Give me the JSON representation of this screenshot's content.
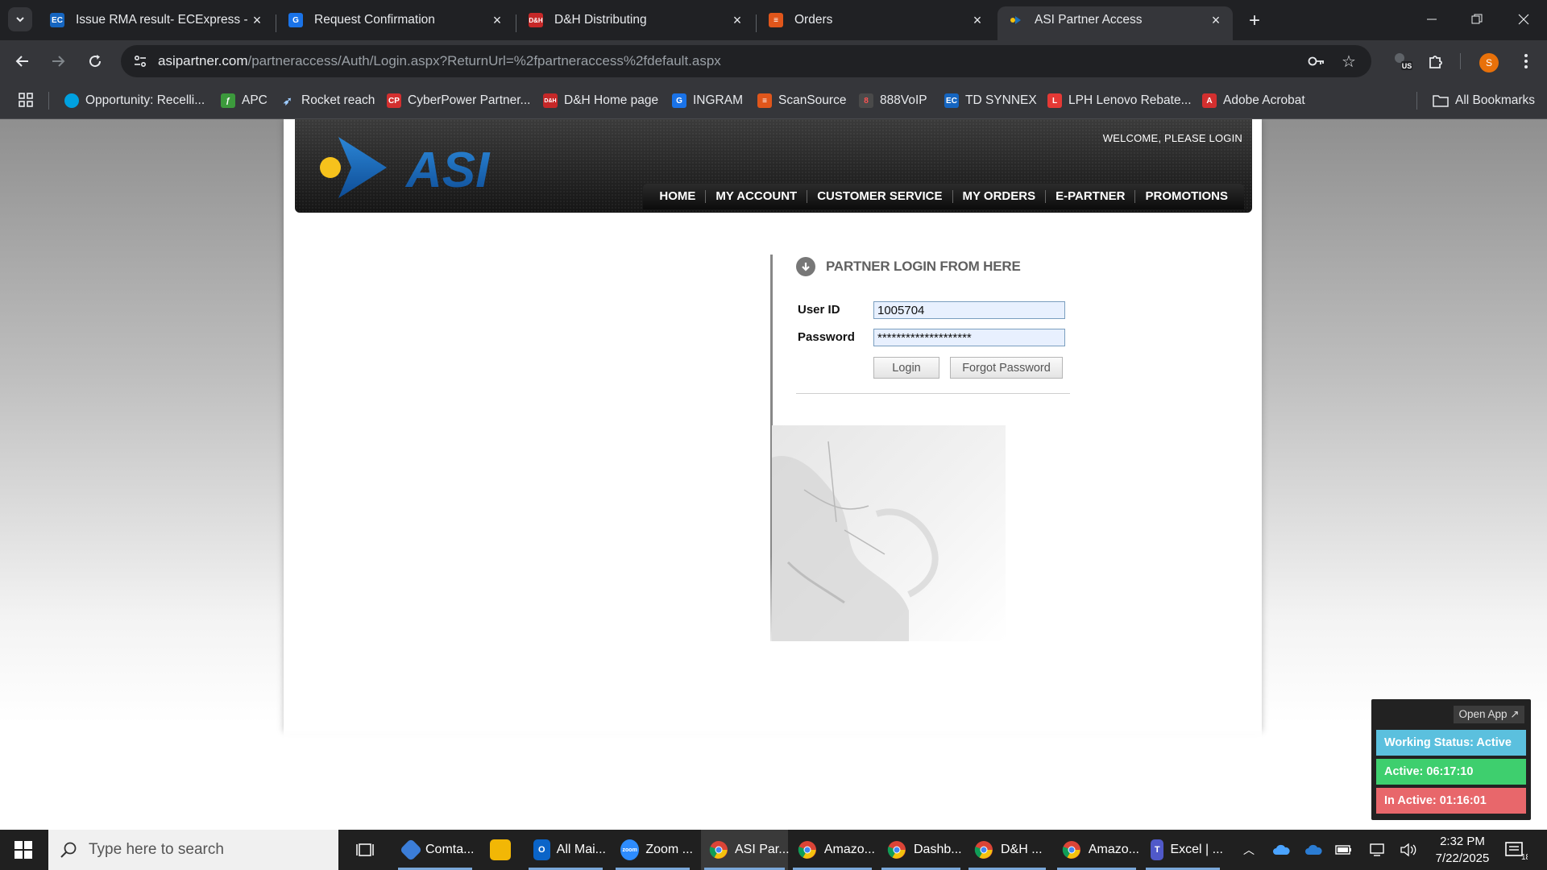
{
  "browser": {
    "tabs": [
      {
        "title": "Issue RMA result- ECExpress - T",
        "favicon": "ec-icon",
        "active": false
      },
      {
        "title": "Request Confirmation",
        "favicon": "g-icon",
        "active": false
      },
      {
        "title": "D&H Distributing",
        "favicon": "dh-icon",
        "active": false
      },
      {
        "title": "Orders",
        "favicon": "orders-icon",
        "active": false
      },
      {
        "title": "ASI Partner Access",
        "favicon": "asi-icon",
        "active": true
      }
    ],
    "address": {
      "host": "asipartner.com",
      "path": "/partneraccess/Auth/Login.aspx?ReturnUrl=%2fpartneraccess%2fdefault.aspx"
    },
    "profile_initial": "S",
    "extension_badge": "US",
    "bookmarks": [
      {
        "label": "Opportunity: Recelli...",
        "icon": "salesforce-icon",
        "color": "#00a1e0"
      },
      {
        "label": "APC",
        "icon": "apc-icon",
        "color": "#3c9a3c"
      },
      {
        "label": "Rocket reach",
        "icon": "rocket-icon",
        "color": "#6a5acd"
      },
      {
        "label": "CyberPower Partner...",
        "icon": "cp-icon",
        "color": "#d32f2f"
      },
      {
        "label": "D&H Home page",
        "icon": "dh-icon",
        "color": "#c62828"
      },
      {
        "label": "INGRAM",
        "icon": "g-icon",
        "color": "#1a73e8"
      },
      {
        "label": "ScanSource",
        "icon": "scansource-icon",
        "color": "#e0561b"
      },
      {
        "label": "888VoIP",
        "icon": "voip-icon",
        "color": "#b71c1c"
      },
      {
        "label": "TD SYNNEX",
        "icon": "ec-icon",
        "color": "#1565c0"
      },
      {
        "label": "LPH Lenovo Rebate...",
        "icon": "l-icon",
        "color": "#e53935"
      },
      {
        "label": "Adobe Acrobat",
        "icon": "acrobat-icon",
        "color": "#d32f2f"
      }
    ],
    "all_bookmarks_label": "All Bookmarks"
  },
  "site": {
    "brand": "ASI",
    "welcome": "WELCOME, PLEASE LOGIN",
    "nav": [
      "HOME",
      "MY ACCOUNT",
      "CUSTOMER SERVICE",
      "MY ORDERS",
      "E-PARTNER",
      "PROMOTIONS"
    ],
    "login": {
      "title": "PARTNER LOGIN FROM HERE",
      "user_label": "User ID",
      "user_value": "1005704",
      "password_label": "Password",
      "password_value": "********************",
      "login_button": "Login",
      "forgot_button": "Forgot Password"
    }
  },
  "widget": {
    "open_app": "Open App ↗",
    "status": "Working Status: Active",
    "active": "Active: 06:17:10",
    "inactive": "In Active: 01:16:01",
    "colors": {
      "status": "#5bc0de",
      "active": "#3ecf6e",
      "inactive": "#e8676b"
    }
  },
  "taskbar": {
    "search_placeholder": "Type here to search",
    "apps": [
      {
        "label": "Comta...",
        "icon": "comtrade-icon",
        "color": "#3b7dd8"
      },
      {
        "label": "",
        "icon": "file-explorer-icon",
        "color": "#f2b705"
      },
      {
        "label": "All Mai...",
        "icon": "outlook-icon",
        "color": "#0a64c8"
      },
      {
        "label": "Zoom ...",
        "icon": "zoom-icon",
        "color": "#2d8cff"
      },
      {
        "label": "ASI Par...",
        "icon": "chrome-icon",
        "color": "#34a853"
      },
      {
        "label": "Amazo...",
        "icon": "chrome-icon",
        "color": "#34a853"
      },
      {
        "label": "Dashb...",
        "icon": "chrome-icon",
        "color": "#34a853"
      },
      {
        "label": "D&H ...",
        "icon": "chrome-icon",
        "color": "#34a853"
      },
      {
        "label": "Amazo...",
        "icon": "chrome-icon",
        "color": "#34a853"
      },
      {
        "label": "Excel | ...",
        "icon": "teams-icon",
        "color": "#5059c9"
      }
    ],
    "time": "2:32 PM",
    "date": "7/22/2025",
    "notification_count": "18"
  }
}
